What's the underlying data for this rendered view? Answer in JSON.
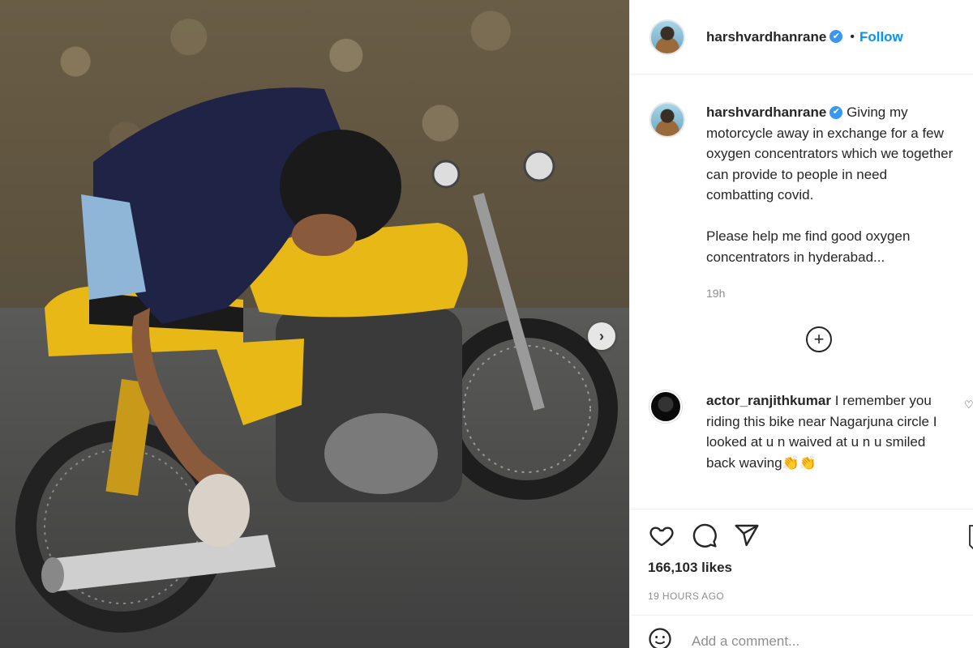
{
  "post": {
    "username": "harshvardhanrane",
    "verified_glyph": "✔",
    "follow_label": "Follow",
    "dot": "•",
    "caption_lines": [
      "Giving my motorcycle away in exchange for a few oxygen concentrators which we together can provide to people in need combatting covid.",
      "Please help me find good oxygen concentrators in hyderabad..."
    ],
    "caption_time": "19h",
    "more_glyph": "+",
    "carousel_next_glyph": "›"
  },
  "comment": {
    "username": "actor_ranjithkumar",
    "text": "I remember you riding this bike near Nagarjuna circle I looked at u n waived at u n u smiled back waving",
    "emoji": "👏👏",
    "heart_glyph": "♡"
  },
  "actions": {
    "likes": "166,103 likes",
    "ago": "19 HOURS AGO",
    "add_comment_placeholder": "Add a comment..."
  },
  "icons": {
    "like": "heart-icon",
    "comment": "comment-icon",
    "share": "share-icon",
    "save": "bookmark-icon",
    "emoji": "emoji-icon"
  },
  "colors": {
    "accent": "#0095f6",
    "verified": "#3897f0",
    "muted": "#8e8e8e",
    "text": "#262626",
    "bike_yellow": "#e8b816"
  }
}
